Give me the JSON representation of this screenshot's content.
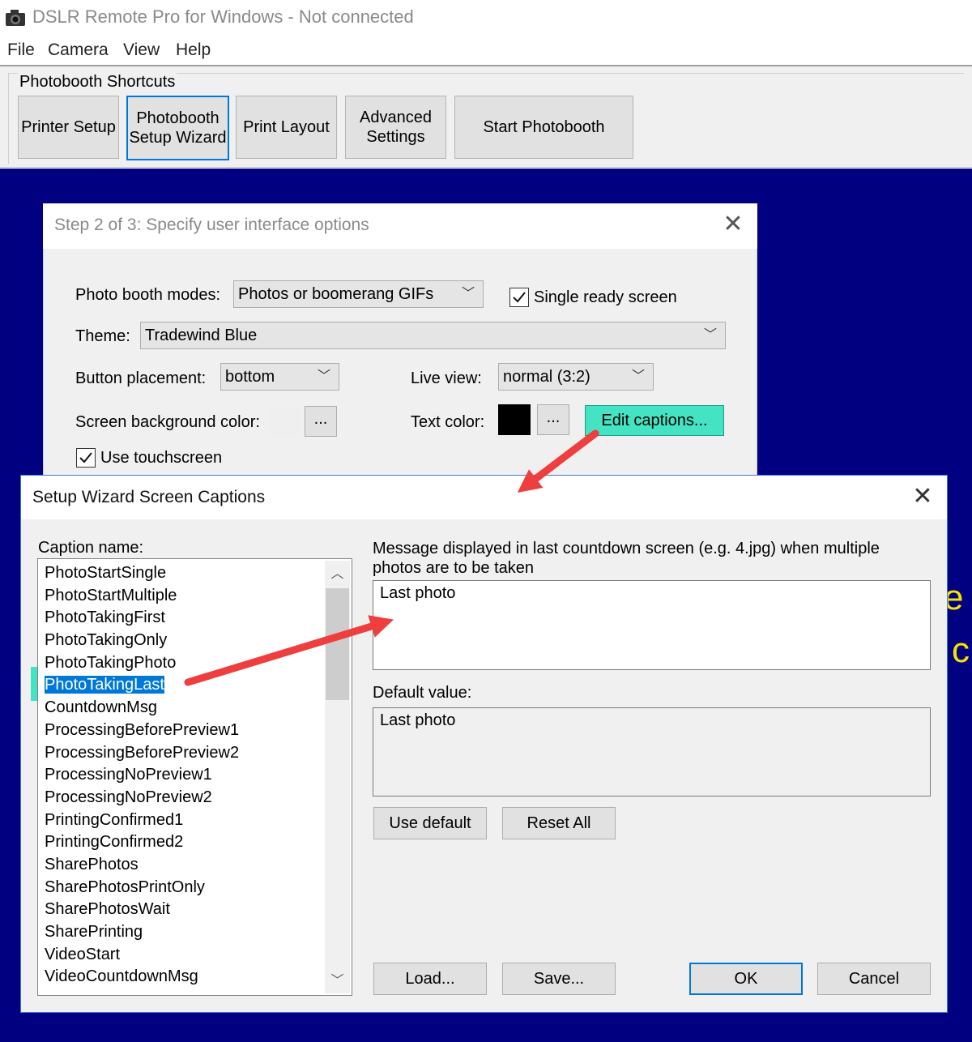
{
  "app": {
    "title": "DSLR Remote Pro for Windows - Not connected"
  },
  "menu": [
    "File",
    "Camera",
    "View",
    "Help"
  ],
  "shortcuts": {
    "group_label": "Photobooth Shortcuts",
    "buttons": [
      "Printer Setup",
      "Photobooth\nSetup Wizard",
      "Print Layout",
      "Advanced\nSettings",
      "Start Photobooth"
    ]
  },
  "background_text": {
    "line1": "e",
    "line2": "c"
  },
  "step_dialog": {
    "title": "Step 2 of 3: Specify user interface options",
    "modes_label": "Photo booth modes:",
    "modes_value": "Photos or boomerang GIFs",
    "single_ready_label": "Single ready screen",
    "single_ready_checked": true,
    "theme_label": "Theme:",
    "theme_value": "Tradewind Blue",
    "button_placement_label": "Button placement:",
    "button_placement_value": "bottom",
    "live_view_label": "Live view:",
    "live_view_value": "normal (3:2)",
    "bg_color_label": "Screen background color:",
    "bg_color_button": "...",
    "text_color_label": "Text color:",
    "text_color_button": "...",
    "text_color": "#000000",
    "edit_captions_label": "Edit captions...",
    "touchscreen_label": "Use touchscreen",
    "touchscreen_checked": true
  },
  "captions_dialog": {
    "title": "Setup Wizard Screen Captions",
    "caption_name_label": "Caption name:",
    "captions": [
      "PhotoStartSingle",
      "PhotoStartMultiple",
      "PhotoTakingFirst",
      "PhotoTakingOnly",
      "PhotoTakingPhoto",
      "PhotoTakingLast",
      "CountdownMsg",
      "ProcessingBeforePreview1",
      "ProcessingBeforePreview2",
      "ProcessingNoPreview1",
      "ProcessingNoPreview2",
      "PrintingConfirmed1",
      "PrintingConfirmed2",
      "SharePhotos",
      "SharePhotosPrintOnly",
      "SharePhotosWait",
      "SharePrinting",
      "VideoStart",
      "VideoCountdownMsg"
    ],
    "selected_caption": "PhotoTakingLast",
    "message_label": "Message displayed in last countdown screen (e.g. 4.jpg) when multiple photos are to be taken",
    "message_value": "Last photo",
    "default_label": "Default value:",
    "default_value": "Last photo",
    "use_default_label": "Use default",
    "reset_all_label": "Reset All",
    "load_label": "Load...",
    "save_label": "Save...",
    "ok_label": "OK",
    "cancel_label": "Cancel"
  },
  "colors": {
    "background_blue": "#000080",
    "highlight": "#43e3c3",
    "annotation_arrow": "#ee3e3e",
    "selection": "#0078d7"
  }
}
